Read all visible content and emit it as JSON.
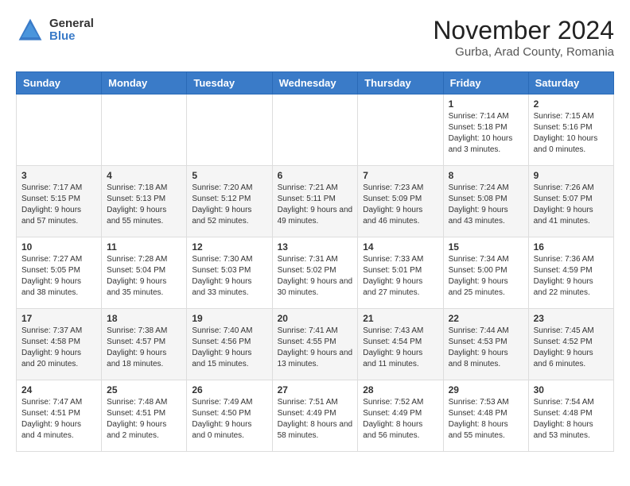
{
  "header": {
    "logo_general": "General",
    "logo_blue": "Blue",
    "month_title": "November 2024",
    "location": "Gurba, Arad County, Romania"
  },
  "weekdays": [
    "Sunday",
    "Monday",
    "Tuesday",
    "Wednesday",
    "Thursday",
    "Friday",
    "Saturday"
  ],
  "weeks": [
    [
      {
        "day": "",
        "sunrise": "",
        "sunset": "",
        "daylight": ""
      },
      {
        "day": "",
        "sunrise": "",
        "sunset": "",
        "daylight": ""
      },
      {
        "day": "",
        "sunrise": "",
        "sunset": "",
        "daylight": ""
      },
      {
        "day": "",
        "sunrise": "",
        "sunset": "",
        "daylight": ""
      },
      {
        "day": "",
        "sunrise": "",
        "sunset": "",
        "daylight": ""
      },
      {
        "day": "1",
        "sunrise": "Sunrise: 7:14 AM",
        "sunset": "Sunset: 5:18 PM",
        "daylight": "Daylight: 10 hours and 3 minutes."
      },
      {
        "day": "2",
        "sunrise": "Sunrise: 7:15 AM",
        "sunset": "Sunset: 5:16 PM",
        "daylight": "Daylight: 10 hours and 0 minutes."
      }
    ],
    [
      {
        "day": "3",
        "sunrise": "Sunrise: 7:17 AM",
        "sunset": "Sunset: 5:15 PM",
        "daylight": "Daylight: 9 hours and 57 minutes."
      },
      {
        "day": "4",
        "sunrise": "Sunrise: 7:18 AM",
        "sunset": "Sunset: 5:13 PM",
        "daylight": "Daylight: 9 hours and 55 minutes."
      },
      {
        "day": "5",
        "sunrise": "Sunrise: 7:20 AM",
        "sunset": "Sunset: 5:12 PM",
        "daylight": "Daylight: 9 hours and 52 minutes."
      },
      {
        "day": "6",
        "sunrise": "Sunrise: 7:21 AM",
        "sunset": "Sunset: 5:11 PM",
        "daylight": "Daylight: 9 hours and 49 minutes."
      },
      {
        "day": "7",
        "sunrise": "Sunrise: 7:23 AM",
        "sunset": "Sunset: 5:09 PM",
        "daylight": "Daylight: 9 hours and 46 minutes."
      },
      {
        "day": "8",
        "sunrise": "Sunrise: 7:24 AM",
        "sunset": "Sunset: 5:08 PM",
        "daylight": "Daylight: 9 hours and 43 minutes."
      },
      {
        "day": "9",
        "sunrise": "Sunrise: 7:26 AM",
        "sunset": "Sunset: 5:07 PM",
        "daylight": "Daylight: 9 hours and 41 minutes."
      }
    ],
    [
      {
        "day": "10",
        "sunrise": "Sunrise: 7:27 AM",
        "sunset": "Sunset: 5:05 PM",
        "daylight": "Daylight: 9 hours and 38 minutes."
      },
      {
        "day": "11",
        "sunrise": "Sunrise: 7:28 AM",
        "sunset": "Sunset: 5:04 PM",
        "daylight": "Daylight: 9 hours and 35 minutes."
      },
      {
        "day": "12",
        "sunrise": "Sunrise: 7:30 AM",
        "sunset": "Sunset: 5:03 PM",
        "daylight": "Daylight: 9 hours and 33 minutes."
      },
      {
        "day": "13",
        "sunrise": "Sunrise: 7:31 AM",
        "sunset": "Sunset: 5:02 PM",
        "daylight": "Daylight: 9 hours and 30 minutes."
      },
      {
        "day": "14",
        "sunrise": "Sunrise: 7:33 AM",
        "sunset": "Sunset: 5:01 PM",
        "daylight": "Daylight: 9 hours and 27 minutes."
      },
      {
        "day": "15",
        "sunrise": "Sunrise: 7:34 AM",
        "sunset": "Sunset: 5:00 PM",
        "daylight": "Daylight: 9 hours and 25 minutes."
      },
      {
        "day": "16",
        "sunrise": "Sunrise: 7:36 AM",
        "sunset": "Sunset: 4:59 PM",
        "daylight": "Daylight: 9 hours and 22 minutes."
      }
    ],
    [
      {
        "day": "17",
        "sunrise": "Sunrise: 7:37 AM",
        "sunset": "Sunset: 4:58 PM",
        "daylight": "Daylight: 9 hours and 20 minutes."
      },
      {
        "day": "18",
        "sunrise": "Sunrise: 7:38 AM",
        "sunset": "Sunset: 4:57 PM",
        "daylight": "Daylight: 9 hours and 18 minutes."
      },
      {
        "day": "19",
        "sunrise": "Sunrise: 7:40 AM",
        "sunset": "Sunset: 4:56 PM",
        "daylight": "Daylight: 9 hours and 15 minutes."
      },
      {
        "day": "20",
        "sunrise": "Sunrise: 7:41 AM",
        "sunset": "Sunset: 4:55 PM",
        "daylight": "Daylight: 9 hours and 13 minutes."
      },
      {
        "day": "21",
        "sunrise": "Sunrise: 7:43 AM",
        "sunset": "Sunset: 4:54 PM",
        "daylight": "Daylight: 9 hours and 11 minutes."
      },
      {
        "day": "22",
        "sunrise": "Sunrise: 7:44 AM",
        "sunset": "Sunset: 4:53 PM",
        "daylight": "Daylight: 9 hours and 8 minutes."
      },
      {
        "day": "23",
        "sunrise": "Sunrise: 7:45 AM",
        "sunset": "Sunset: 4:52 PM",
        "daylight": "Daylight: 9 hours and 6 minutes."
      }
    ],
    [
      {
        "day": "24",
        "sunrise": "Sunrise: 7:47 AM",
        "sunset": "Sunset: 4:51 PM",
        "daylight": "Daylight: 9 hours and 4 minutes."
      },
      {
        "day": "25",
        "sunrise": "Sunrise: 7:48 AM",
        "sunset": "Sunset: 4:51 PM",
        "daylight": "Daylight: 9 hours and 2 minutes."
      },
      {
        "day": "26",
        "sunrise": "Sunrise: 7:49 AM",
        "sunset": "Sunset: 4:50 PM",
        "daylight": "Daylight: 9 hours and 0 minutes."
      },
      {
        "day": "27",
        "sunrise": "Sunrise: 7:51 AM",
        "sunset": "Sunset: 4:49 PM",
        "daylight": "Daylight: 8 hours and 58 minutes."
      },
      {
        "day": "28",
        "sunrise": "Sunrise: 7:52 AM",
        "sunset": "Sunset: 4:49 PM",
        "daylight": "Daylight: 8 hours and 56 minutes."
      },
      {
        "day": "29",
        "sunrise": "Sunrise: 7:53 AM",
        "sunset": "Sunset: 4:48 PM",
        "daylight": "Daylight: 8 hours and 55 minutes."
      },
      {
        "day": "30",
        "sunrise": "Sunrise: 7:54 AM",
        "sunset": "Sunset: 4:48 PM",
        "daylight": "Daylight: 8 hours and 53 minutes."
      }
    ]
  ]
}
